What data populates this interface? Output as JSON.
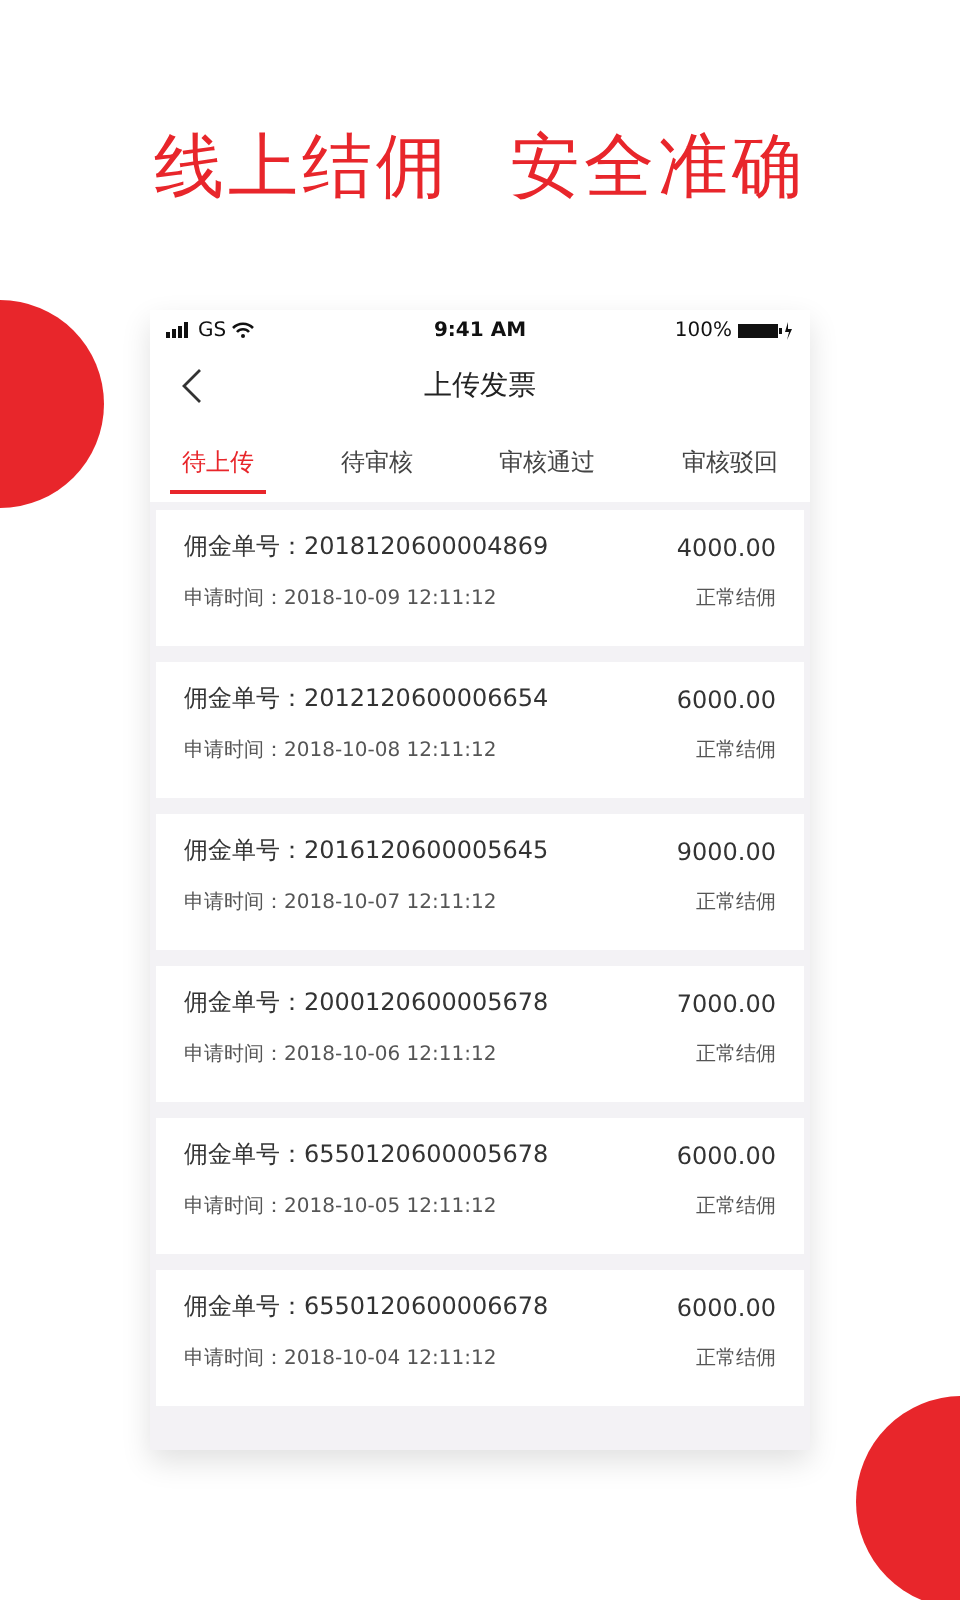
{
  "headline": [
    "线上结佣",
    "安全准确"
  ],
  "status_bar": {
    "carrier": "GS",
    "time": "9:41 AM",
    "battery": "100%"
  },
  "nav": {
    "title": "上传发票"
  },
  "tabs": [
    {
      "label": "待上传",
      "selected": true
    },
    {
      "label": "待审核",
      "selected": false
    },
    {
      "label": "审核通过",
      "selected": false
    },
    {
      "label": "审核驳回",
      "selected": false
    }
  ],
  "orders": [
    {
      "number": "佣金单号：2018120600004869",
      "amount": "4000.00",
      "time": "申请时间：2018-10-09 12:11:12",
      "status": "正常结佣"
    },
    {
      "number": "佣金单号：2012120600006654",
      "amount": "6000.00",
      "time": "申请时间：2018-10-08 12:11:12",
      "status": "正常结佣"
    },
    {
      "number": "佣金单号：2016120600005645",
      "amount": "9000.00",
      "time": "申请时间：2018-10-07 12:11:12",
      "status": "正常结佣"
    },
    {
      "number": "佣金单号：2000120600005678",
      "amount": "7000.00",
      "time": "申请时间：2018-10-06 12:11:12",
      "status": "正常结佣"
    },
    {
      "number": "佣金单号：6550120600005678",
      "amount": "6000.00",
      "time": "申请时间：2018-10-05 12:11:12",
      "status": "正常结佣"
    },
    {
      "number": "佣金单号：6550120600006678",
      "amount": "6000.00",
      "time": "申请时间：2018-10-04 12:11:12",
      "status": "正常结佣"
    }
  ]
}
